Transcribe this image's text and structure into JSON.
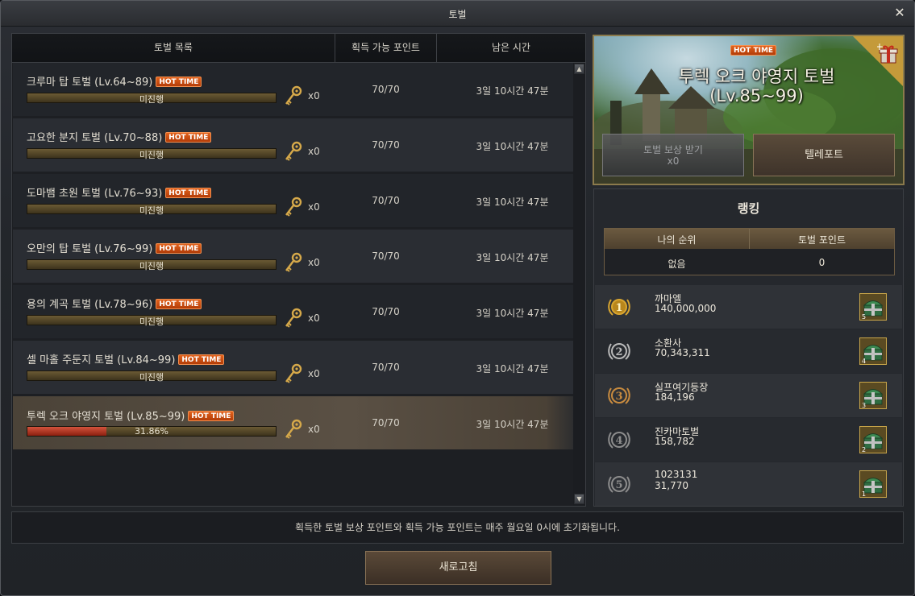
{
  "window": {
    "title": "토벌",
    "close_label": "✕"
  },
  "list": {
    "headers": {
      "name": "토벌 목록",
      "points": "획득 가능 포인트",
      "time": "남은 시간"
    },
    "hot_label": "HOT TIME",
    "rows": [
      {
        "title": "크루마 탑 토벌 (Lv.64~89)",
        "progress_text": "미진행",
        "progress": 0,
        "keys": "x0",
        "points": "70/70",
        "time": "3일 10시간 47분"
      },
      {
        "title": "고요한 분지  토벌 (Lv.70~88)",
        "progress_text": "미진행",
        "progress": 0,
        "keys": "x0",
        "points": "70/70",
        "time": "3일 10시간 47분"
      },
      {
        "title": "도마뱀 초원  토벌 (Lv.76~93)",
        "progress_text": "미진행",
        "progress": 0,
        "keys": "x0",
        "points": "70/70",
        "time": "3일 10시간 47분"
      },
      {
        "title": "오만의 탑  토벌 (Lv.76~99)",
        "progress_text": "미진행",
        "progress": 0,
        "keys": "x0",
        "points": "70/70",
        "time": "3일 10시간 47분"
      },
      {
        "title": "용의 계곡  토벌 (Lv.78~96)",
        "progress_text": "미진행",
        "progress": 0,
        "keys": "x0",
        "points": "70/70",
        "time": "3일 10시간 47분"
      },
      {
        "title": "셀 마홀 주둔지  토벌 (Lv.84~99)",
        "progress_text": "미진행",
        "progress": 0,
        "keys": "x0",
        "points": "70/70",
        "time": "3일 10시간 47분"
      },
      {
        "title": "투렉 오크 야영지  토벌 (Lv.85~99)",
        "progress_text": "31.86%",
        "progress": 0.3186,
        "keys": "x0",
        "points": "70/70",
        "time": "3일 10시간 47분"
      }
    ],
    "scroll_up": "▲",
    "scroll_down": "▼"
  },
  "banner": {
    "hot_label": "HOT TIME",
    "title_line1": "투렉 오크 야영지  토벌",
    "title_line2": "(Lv.85~99)",
    "reward_button_label": "토벌 보상 받기",
    "reward_button_count": "x0",
    "teleport_button_label": "텔레포트",
    "gift_icon": "gift-box-icon"
  },
  "ranking": {
    "title": "랭킹",
    "my_rank_header": "나의 순위",
    "my_points_header": "토벌 포인트",
    "my_rank_value": "없음",
    "my_points_value": "0",
    "entries": [
      {
        "rank": "1",
        "name": "까마엘",
        "score": "140,000,000",
        "reward_count": "5"
      },
      {
        "rank": "2",
        "name": "소환사",
        "score": "70,343,311",
        "reward_count": "4"
      },
      {
        "rank": "3",
        "name": "실프여기등장",
        "score": "184,196",
        "reward_count": "3"
      },
      {
        "rank": "4",
        "name": "진카마토벌",
        "score": "158,782",
        "reward_count": "2"
      },
      {
        "rank": "5",
        "name": "1023131",
        "score": "31,770",
        "reward_count": "1"
      }
    ]
  },
  "notice": "획득한 토벌 보상 포인트와 획득 가능 포인트는 매주 월요일 0시에 초기화됩니다.",
  "refresh_button_label": "새로고침",
  "colors": {
    "hot": "#d9541a",
    "progress_fill": "#c0412a",
    "gold": "#c49a3a"
  }
}
